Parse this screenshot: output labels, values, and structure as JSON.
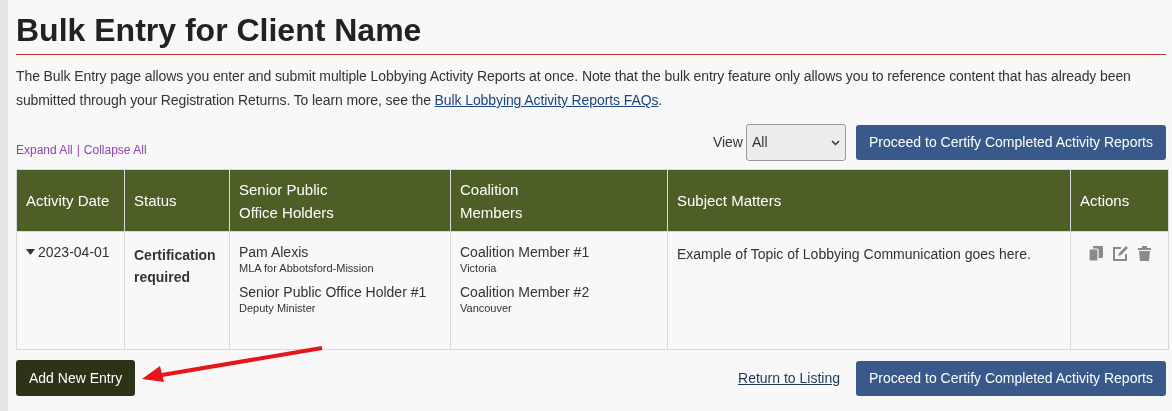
{
  "page_title": "Bulk Entry for Client Name",
  "intro": {
    "text": "The Bulk Entry page allows you enter and submit multiple Lobbying Activity Reports at once. Note that the bulk entry feature only allows you to reference content that has already been submitted through your Registration Returns. To learn more, see the",
    "link": "Bulk Lobbying Activity Reports FAQs",
    "end": "."
  },
  "toolbar": {
    "expand_all": "Expand All",
    "separator": "|",
    "collapse_all": "Collapse All",
    "view_label": "View",
    "view_value": "All",
    "certify_button": "Proceed to Certify Completed Activity Reports"
  },
  "table": {
    "columns": [
      "Activity Date",
      "Status",
      "Senior Public Office Holders",
      "Coalition Members",
      "Subject Matters",
      "Actions"
    ],
    "rows": [
      {
        "activity_date": "2023-04-01",
        "expanded": true,
        "status": "Certification required",
        "office_holders": [
          {
            "name": "Pam Alexis",
            "title": "MLA for Abbotsford-Mission"
          },
          {
            "name": "Senior Public Office Holder #1",
            "title": "Deputy Minister"
          }
        ],
        "coalition_members": [
          {
            "name": "Coalition Member #1",
            "location": "Victoria"
          },
          {
            "name": "Coalition Member #2",
            "location": "Vancouver"
          }
        ],
        "subject_matters": "Example of Topic of Lobbying Communication goes here."
      }
    ]
  },
  "footer": {
    "add_button": "Add New Entry",
    "return_link": "Return to Listing",
    "certify_button": "Proceed to Certify Completed Activity Reports"
  },
  "annotations": [
    {
      "kind": "arrow"
    }
  ]
}
